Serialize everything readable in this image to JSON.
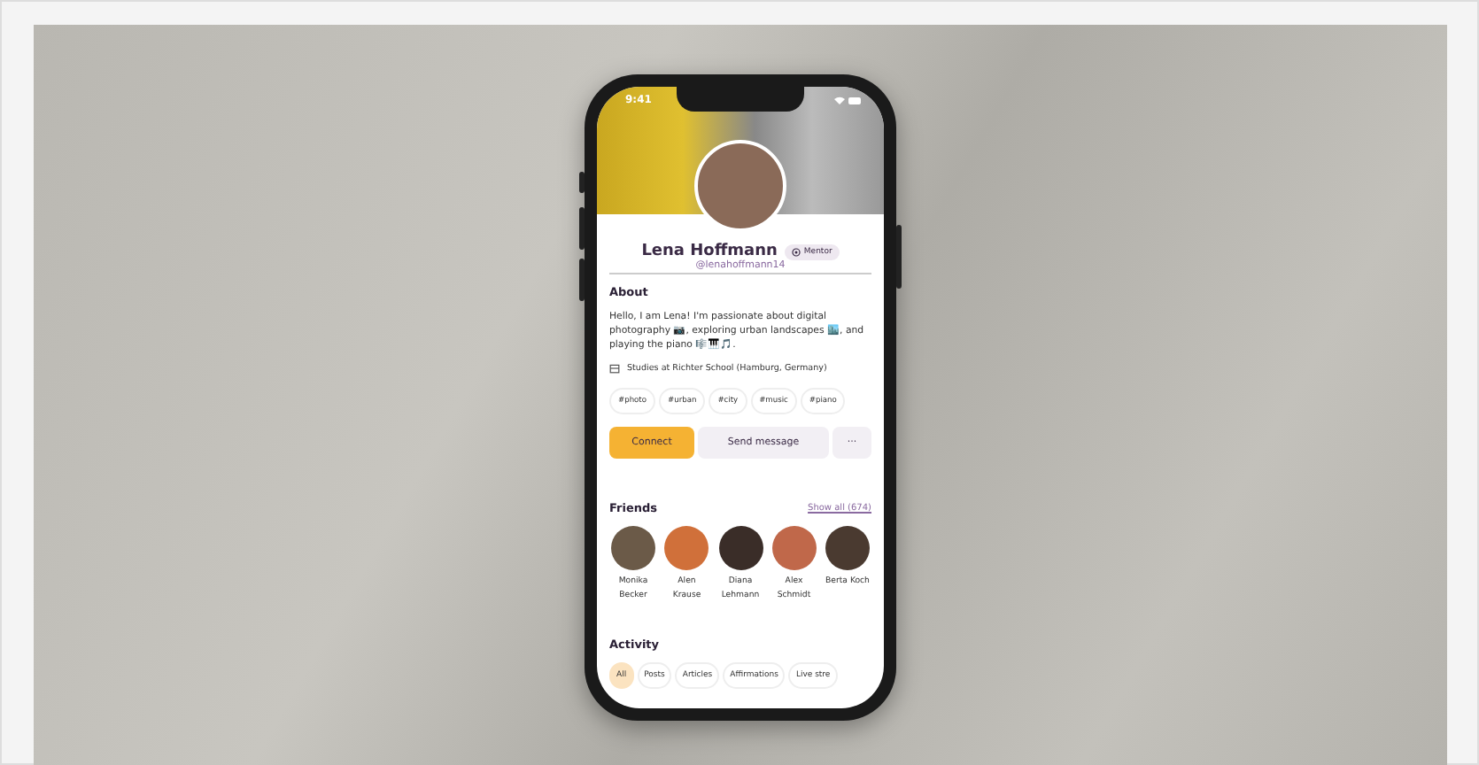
{
  "status_bar": {
    "time": "9:41"
  },
  "profile": {
    "name": "Lena Hoffmann",
    "badge": "Mentor",
    "handle": "@lenahoffmann14"
  },
  "about": {
    "title": "About",
    "text": "Hello, I am Lena! I'm passionate about digital photography 📷, exploring urban landscapes 🏙️, and playing the piano 🎼🎹🎵.",
    "school": "Studies at Richter School (Hamburg, Germany)"
  },
  "tags": [
    "#photo",
    "#urban",
    "#city",
    "#music",
    "#piano"
  ],
  "actions": [
    {
      "label": "Connect",
      "kind": "primary"
    },
    {
      "label": "Send message",
      "kind": "secondary"
    },
    {
      "label": "···",
      "kind": "more"
    }
  ],
  "friends": {
    "title": "Friends",
    "show_all": "Show all (674)",
    "items": [
      {
        "name": "Monika Becker",
        "color": "#6b5a48"
      },
      {
        "name": "Alen Krause",
        "color": "#d0703a"
      },
      {
        "name": "Diana Lehmann",
        "color": "#3a2d28"
      },
      {
        "name": "Alex Schmidt",
        "color": "#c0684a"
      },
      {
        "name": "Berta Koch",
        "color": "#4a3a30"
      }
    ]
  },
  "activity": {
    "title": "Activity",
    "tabs": [
      {
        "label": "All",
        "selected": true
      },
      {
        "label": "Posts",
        "selected": false
      },
      {
        "label": "Articles",
        "selected": false
      },
      {
        "label": "Affirmations",
        "selected": false
      },
      {
        "label": "Live stre",
        "selected": false
      }
    ]
  }
}
